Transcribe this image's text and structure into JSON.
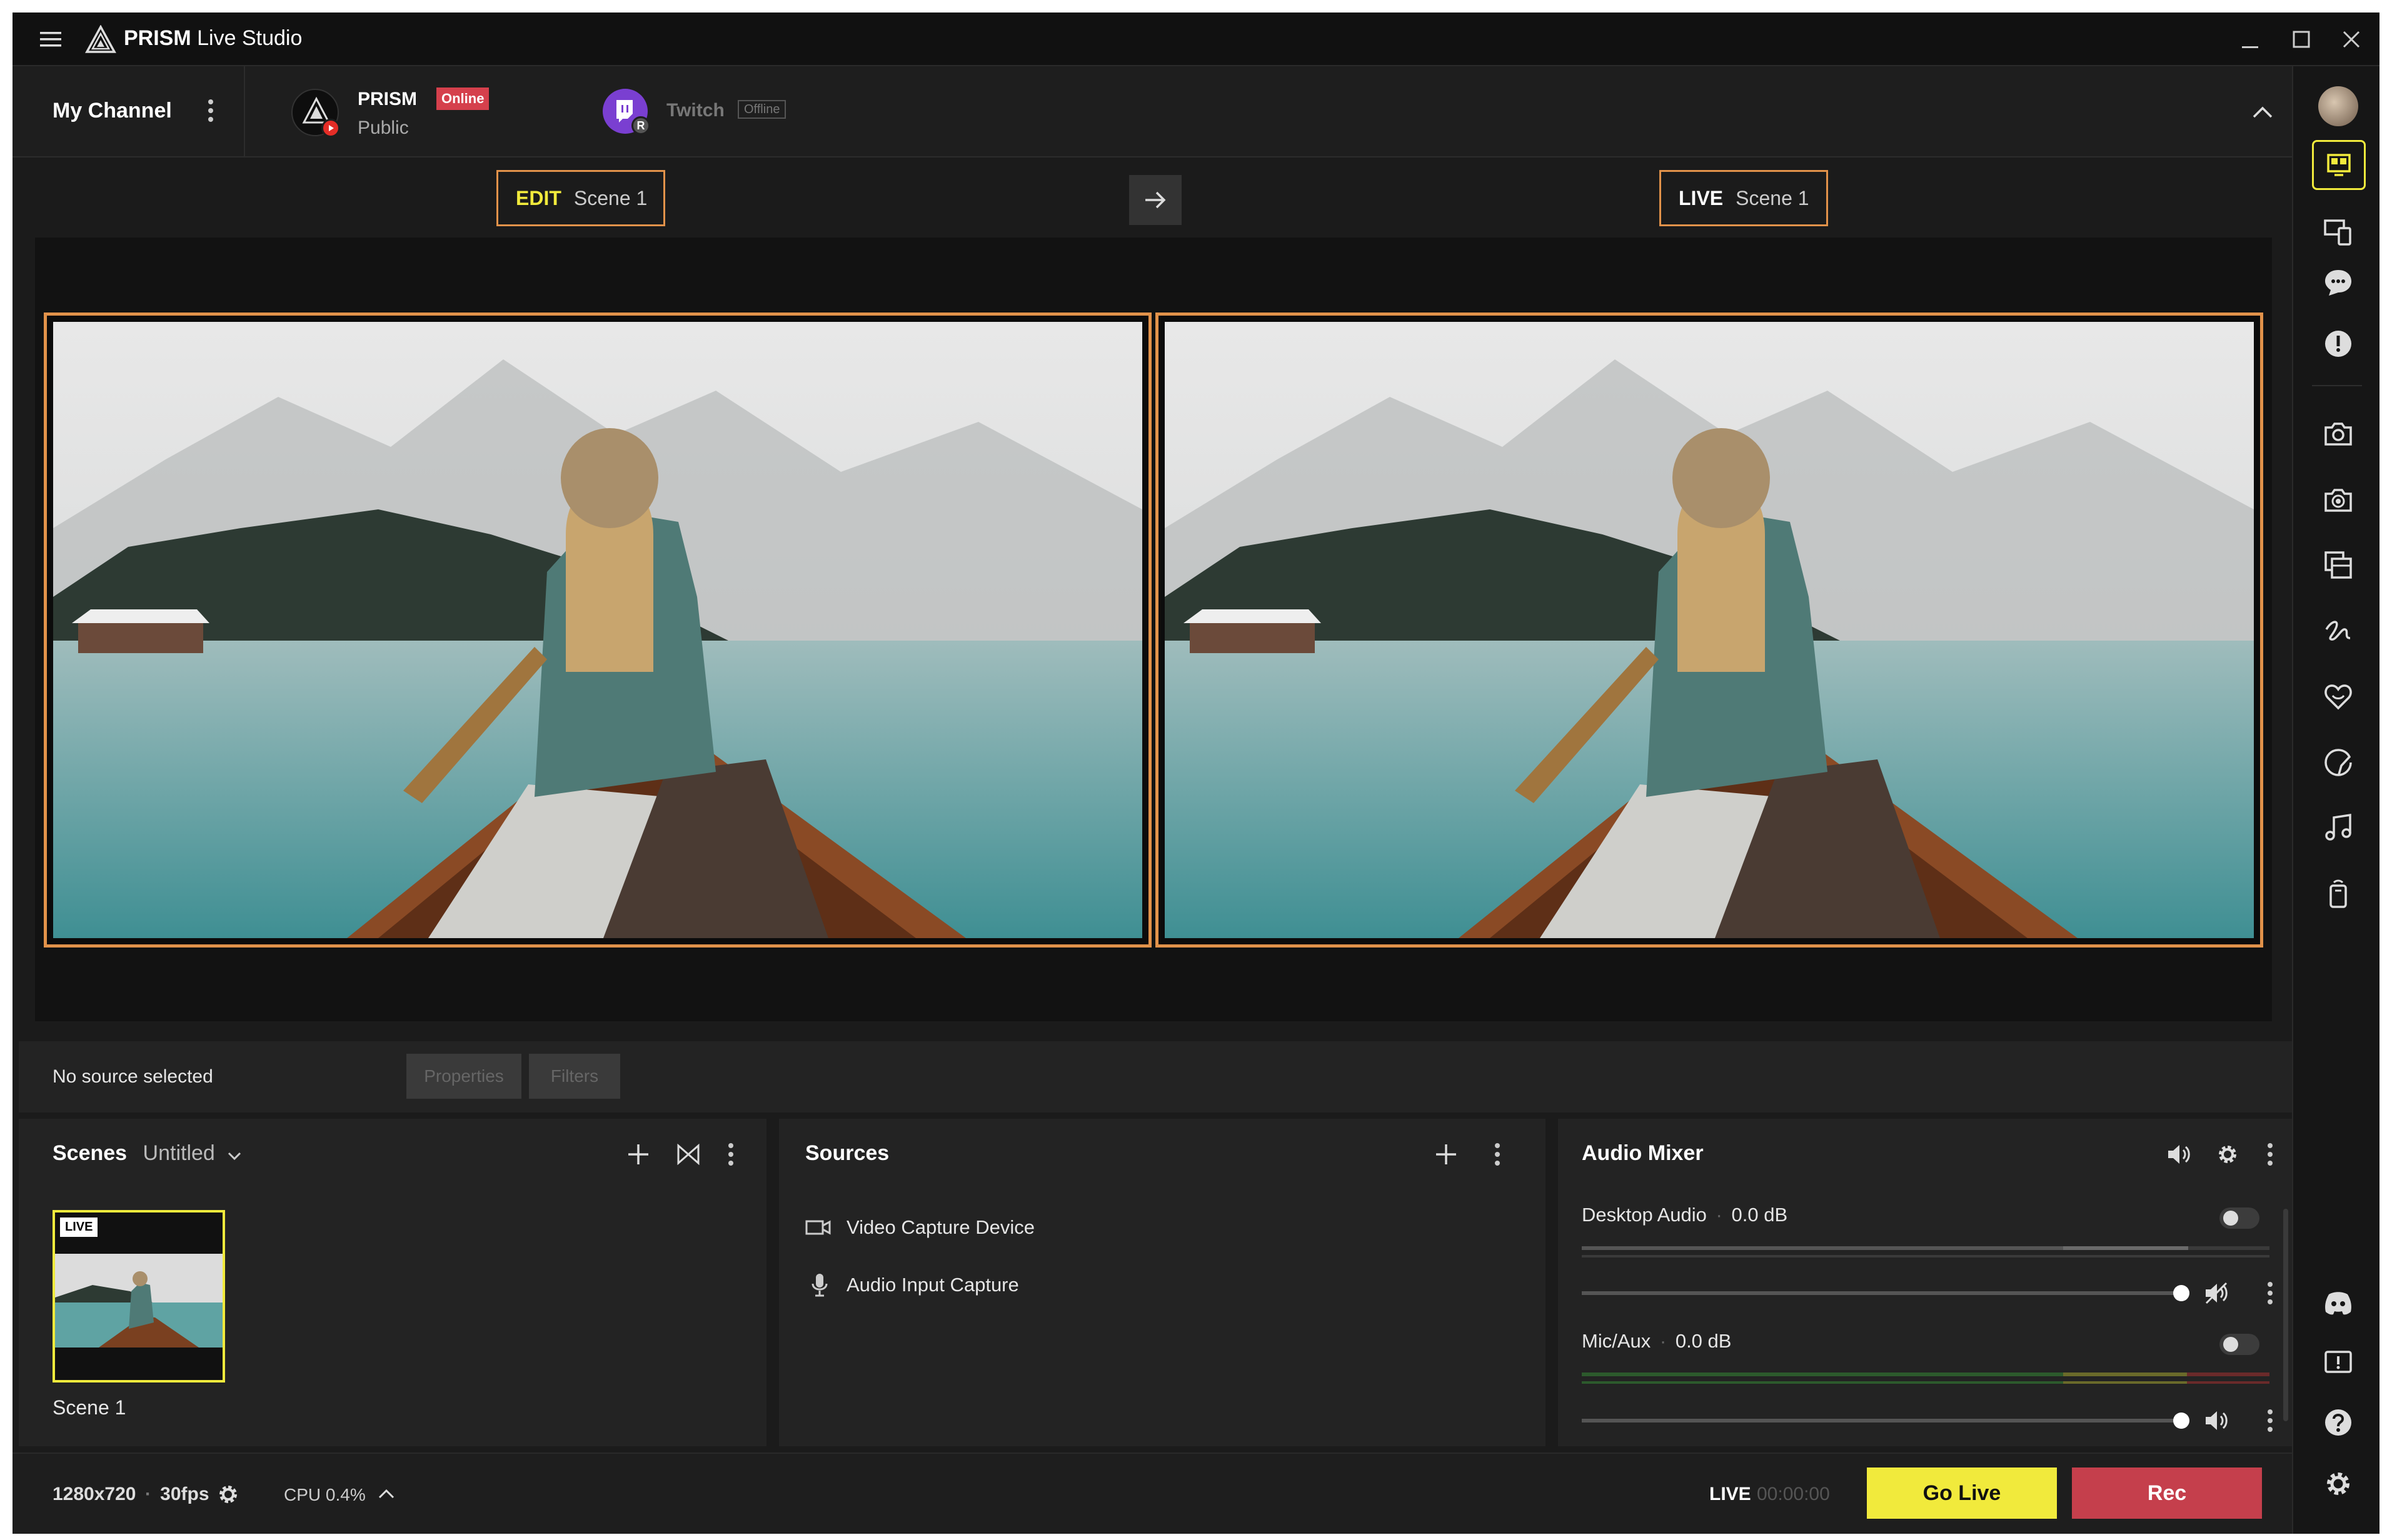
{
  "app": {
    "title_bold": "PRISM",
    "title_rest": "Live Studio"
  },
  "channel": {
    "label": "My Channel"
  },
  "platforms": [
    {
      "name": "PRISM",
      "badge": "Online",
      "sub": "Public"
    },
    {
      "name": "Twitch",
      "badge": "Offline"
    }
  ],
  "edit": {
    "tag": "EDIT",
    "scene": "Scene 1"
  },
  "live": {
    "tag": "LIVE",
    "scene": "Scene 1"
  },
  "source_bar": {
    "status": "No source selected",
    "properties": "Properties",
    "filters": "Filters"
  },
  "scenes": {
    "title": "Scenes",
    "collection": "Untitled",
    "items": [
      {
        "name": "Scene 1",
        "badge": "LIVE"
      }
    ]
  },
  "sources": {
    "title": "Sources",
    "items": [
      {
        "name": "Video Capture Device",
        "icon": "camera-icon"
      },
      {
        "name": "Audio Input Capture",
        "icon": "microphone-icon"
      }
    ]
  },
  "mixer": {
    "title": "Audio Mixer",
    "channels": [
      {
        "name": "Desktop Audio",
        "db": "0.0 dB",
        "level": 1.0,
        "muted": true
      },
      {
        "name": "Mic/Aux",
        "db": "0.0 dB",
        "level": 1.0,
        "muted": false
      }
    ]
  },
  "status": {
    "resolution": "1280x720",
    "fps": "30fps",
    "cpu": "CPU 0.4%",
    "live_label": "LIVE",
    "timer": "00:00:00",
    "go_live": "Go Live",
    "rec": "Rec"
  },
  "colors": {
    "accent_orange": "#e2924a",
    "go_live": "#f1ea3c",
    "rec": "#c53f4c",
    "badge_red": "#d5404c"
  }
}
